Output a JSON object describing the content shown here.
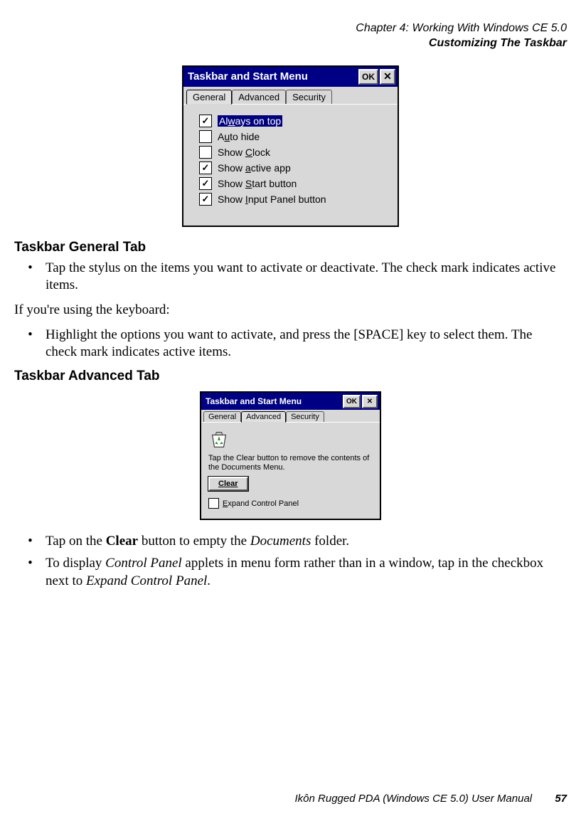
{
  "header": {
    "line1": "Chapter 4: Working With Windows CE 5.0",
    "line2": "Customizing The Taskbar"
  },
  "dialog1": {
    "title": "Taskbar and Start Menu",
    "ok": "OK",
    "tabs": {
      "general": "General",
      "advanced": "Advanced",
      "security": "Security"
    },
    "opts": {
      "alwaysTop": {
        "pre": "Al",
        "u": "w",
        "post": "ays on top",
        "checked": true,
        "selected": true
      },
      "autoHide": {
        "pre": "A",
        "u": "u",
        "post": "to hide",
        "checked": false,
        "selected": false
      },
      "showClock": {
        "pre": "Show ",
        "u": "C",
        "post": "lock",
        "checked": false,
        "selected": false
      },
      "showActive": {
        "pre": "Show ",
        "u": "a",
        "post": "ctive app",
        "checked": true,
        "selected": false
      },
      "showStart": {
        "pre": "Show ",
        "u": "S",
        "post": "tart button",
        "checked": true,
        "selected": false
      },
      "showInput": {
        "pre": "Show ",
        "u": "I",
        "post": "nput Panel button",
        "checked": true,
        "selected": false
      }
    }
  },
  "section1": {
    "heading": "Taskbar General Tab",
    "bullet1": "Tap the stylus on the items you want to activate or deactivate. The check mark indicates active items.",
    "para": "If you're using the keyboard:",
    "bullet2": "Highlight the options you want to activate, and press the [SPACE] key to select them. The check mark indicates active items."
  },
  "section2": {
    "heading": "Taskbar Advanced Tab"
  },
  "dialog2": {
    "title": "Taskbar and Start Menu",
    "ok": "OK",
    "tabs": {
      "general": "General",
      "advanced": "Advanced",
      "security": "Security"
    },
    "help": "Tap the Clear button to remove the contents of the Documents Menu.",
    "clear": "Clear",
    "expand": {
      "pre": "",
      "u": "E",
      "post": "xpand Control Panel",
      "checked": false
    }
  },
  "section3": {
    "bullet1_pre": "Tap on the ",
    "bullet1_b": "Clear",
    "bullet1_mid": " button to empty the ",
    "bullet1_i": "Documents",
    "bullet1_post": " folder.",
    "bullet2_pre": "To display ",
    "bullet2_i1": "Control Panel",
    "bullet2_mid": " applets in menu form rather than in a window, tap in the checkbox next to ",
    "bullet2_i2": "Expand Control Panel",
    "bullet2_post": "."
  },
  "footer": {
    "text": "Ikôn Rugged PDA (Windows CE 5.0) User Manual",
    "page": "57"
  }
}
